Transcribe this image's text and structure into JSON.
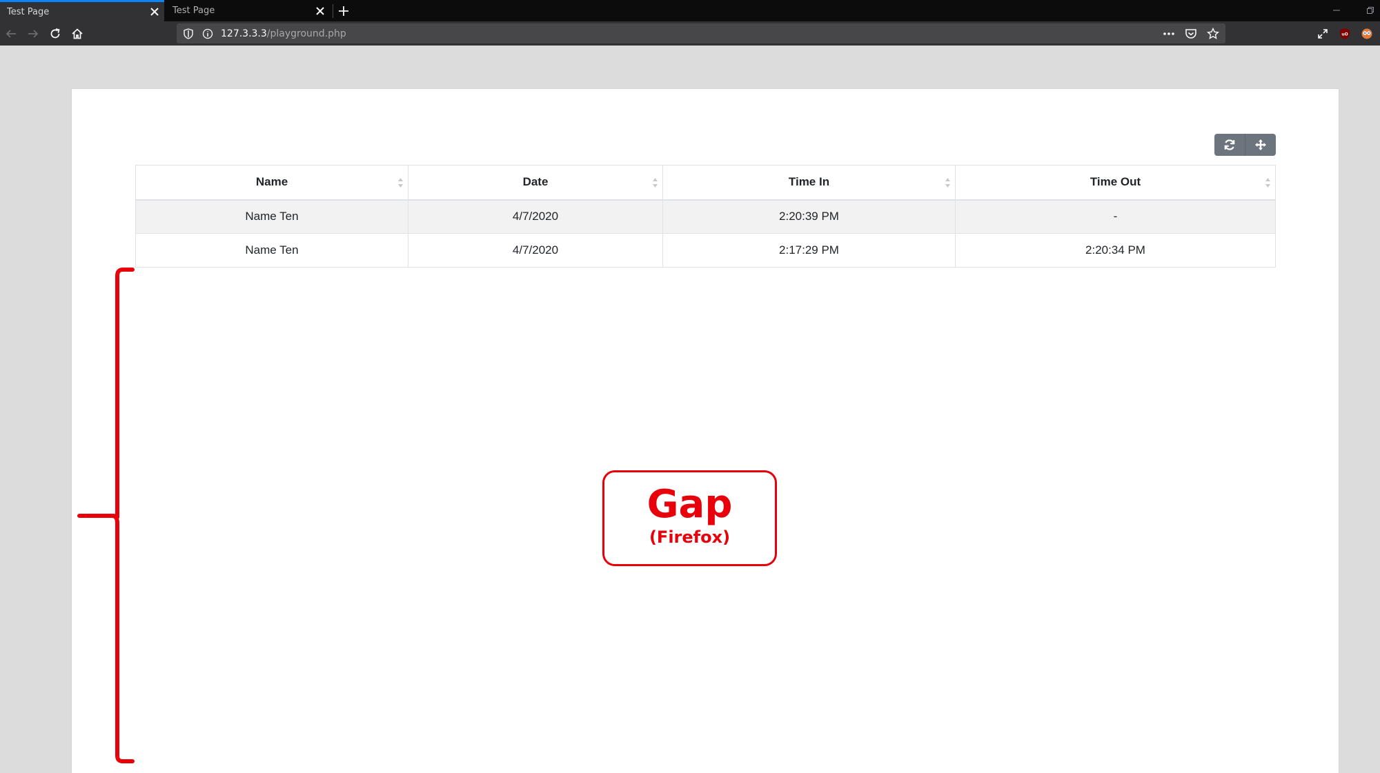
{
  "browser": {
    "tabs": [
      {
        "title": "Test Page",
        "active": true
      },
      {
        "title": "Test Page",
        "active": false
      }
    ],
    "url": {
      "host": "127.3.3.3",
      "path": "/playground.php"
    },
    "colors": {
      "tab_accent": "#0a84ff",
      "chrome_bg": "#0c0c0d",
      "toolbar_bg": "#323234"
    }
  },
  "page": {
    "toolbar": {
      "refresh_icon": "refresh-icon",
      "move_icon": "move-icon"
    },
    "table": {
      "columns": [
        "Name",
        "Date",
        "Time In",
        "Time Out"
      ],
      "rows": [
        [
          "Name Ten",
          "4/7/2020",
          "2:20:39 PM",
          "-"
        ],
        [
          "Name Ten",
          "4/7/2020",
          "2:17:29 PM",
          "2:20:34 PM"
        ]
      ]
    }
  },
  "annotation": {
    "title": "Gap",
    "subtitle": "(Firefox)",
    "color": "#e8000b"
  }
}
